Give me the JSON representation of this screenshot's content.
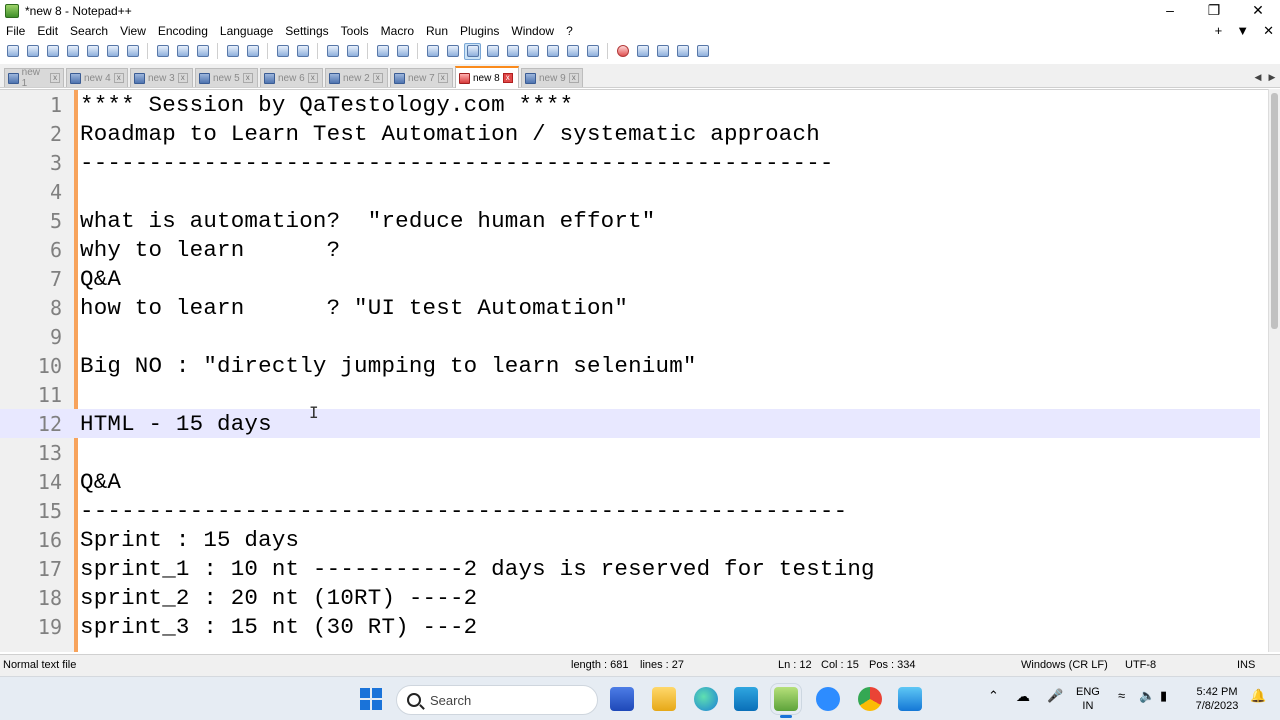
{
  "window": {
    "title": "*new 8 - Notepad++"
  },
  "menu": [
    "File",
    "Edit",
    "Search",
    "View",
    "Encoding",
    "Language",
    "Settings",
    "Tools",
    "Macro",
    "Run",
    "Plugins",
    "Window",
    "?"
  ],
  "menu_right": {
    "add": "+",
    "dropdown": "▼",
    "close": "✕"
  },
  "tabs": [
    {
      "label": "new 1",
      "active": false
    },
    {
      "label": "new 4",
      "active": false
    },
    {
      "label": "new 3",
      "active": false
    },
    {
      "label": "new 5",
      "active": false
    },
    {
      "label": "new 6",
      "active": false
    },
    {
      "label": "new 2",
      "active": false
    },
    {
      "label": "new 7",
      "active": false
    },
    {
      "label": "new 8",
      "active": true
    },
    {
      "label": "new 9",
      "active": false
    }
  ],
  "editor": {
    "current_line": 12,
    "lines": [
      {
        "n": "1",
        "text": "**** Session by QaTestology.com ****"
      },
      {
        "n": "2",
        "text": "Roadmap to Learn Test Automation / systematic approach"
      },
      {
        "n": "3",
        "text": "-------------------------------------------------------"
      },
      {
        "n": "4",
        "text": ""
      },
      {
        "n": "5",
        "text": "what is automation?  \"reduce human effort\""
      },
      {
        "n": "6",
        "text": "why to learn      ?"
      },
      {
        "n": "7",
        "text": "Q&A"
      },
      {
        "n": "8",
        "text": "how to learn      ? \"UI test Automation\""
      },
      {
        "n": "9",
        "text": ""
      },
      {
        "n": "10",
        "text": "Big NO : \"directly jumping to learn selenium\""
      },
      {
        "n": "11",
        "text": ""
      },
      {
        "n": "12",
        "text": "HTML - 15 days"
      },
      {
        "n": "13",
        "text": ""
      },
      {
        "n": "14",
        "text": "Q&A"
      },
      {
        "n": "15",
        "text": "--------------------------------------------------------"
      },
      {
        "n": "16",
        "text": "Sprint : 15 days"
      },
      {
        "n": "17",
        "text": "sprint_1 : 10 nt -----------2 days is reserved for testing"
      },
      {
        "n": "18",
        "text": "sprint_2 : 20 nt (10RT) ----2"
      },
      {
        "n": "19",
        "text": "sprint_3 : 15 nt (30 RT) ---2"
      }
    ]
  },
  "status": {
    "file_type": "Normal text file",
    "length": "length : 681",
    "lines": "lines : 27",
    "ln": "Ln : 12",
    "col": "Col : 15",
    "pos": "Pos : 334",
    "eol": "Windows (CR LF)",
    "encoding": "UTF-8",
    "mode": "INS"
  },
  "taskbar": {
    "search_placeholder": "Search",
    "lang_top": "ENG",
    "lang_bottom": "IN",
    "time": "5:42 PM",
    "date": "7/8/2023"
  },
  "colors": {
    "accent": "#fa8a1b",
    "current_line_bg": "#e8e8ff",
    "gutter_bg": "#f0f0f0"
  }
}
